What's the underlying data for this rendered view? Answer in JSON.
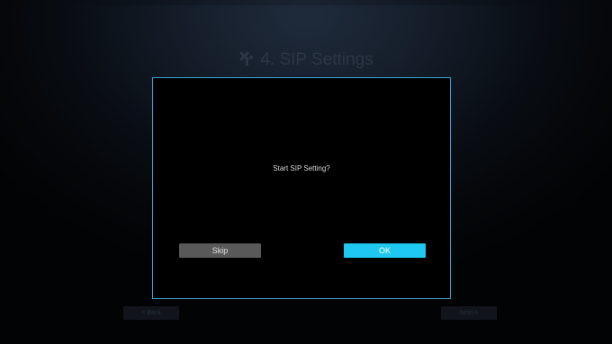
{
  "header": {
    "title": "4. SIP Settings",
    "icon": "tools-icon"
  },
  "nav": {
    "back_label": "< Back",
    "next_label": "Next >"
  },
  "dialog": {
    "message": "Start SIP Setting?",
    "skip_label": "Skip",
    "ok_label": "OK"
  },
  "colors": {
    "accent": "#1ec8f0",
    "dialog_border": "#3aa7d6",
    "skip_button": "#595959"
  }
}
